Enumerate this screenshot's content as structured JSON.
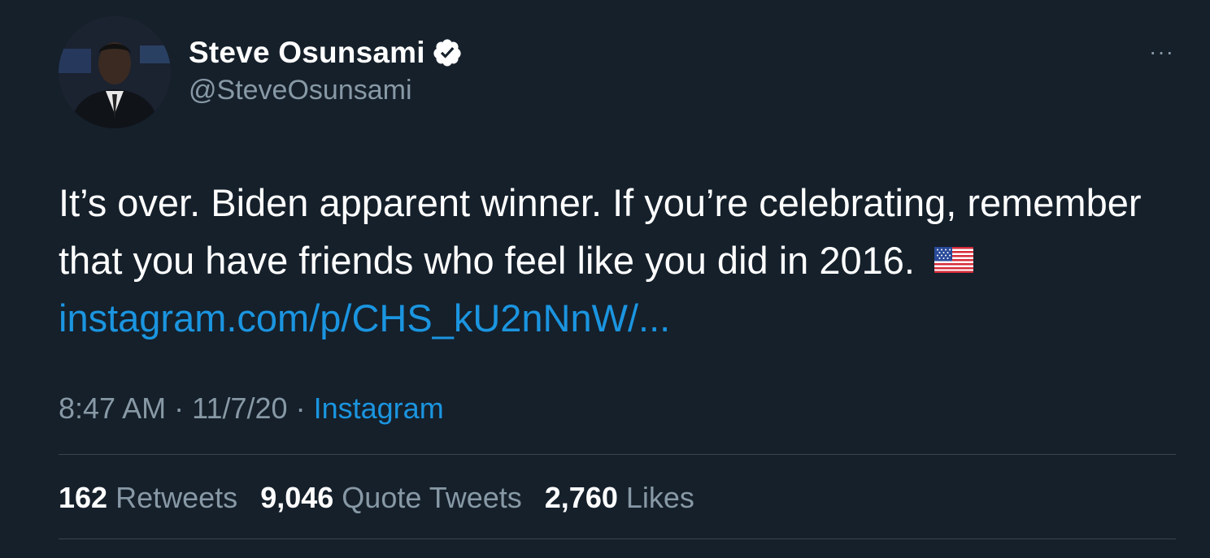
{
  "author": {
    "display_name": "Steve Osunsami",
    "handle": "@SteveOsunsami",
    "verified": true,
    "avatar_icon": "profile-photo"
  },
  "more_label": "···",
  "tweet": {
    "text_line1": "It’s over. Biden apparent winner. If you’re celebrating, remember",
    "text_line2": "that you have friends who feel like you did in 2016.",
    "emoji": "us-flag-emoji",
    "link": "instagram.com/p/CHS_kU2nNnW/..."
  },
  "meta": {
    "time": "8:47 AM",
    "separator": "·",
    "date": "11/7/20",
    "source": "Instagram"
  },
  "stats": {
    "retweets_count": "162",
    "retweets_label": "Retweets",
    "quotes_count": "9,046",
    "quotes_label": "Quote Tweets",
    "likes_count": "2,760",
    "likes_label": "Likes"
  },
  "colors": {
    "background": "#15202b",
    "link": "#1b95e0",
    "secondary_text": "#8899a6",
    "divider": "#38444d"
  }
}
